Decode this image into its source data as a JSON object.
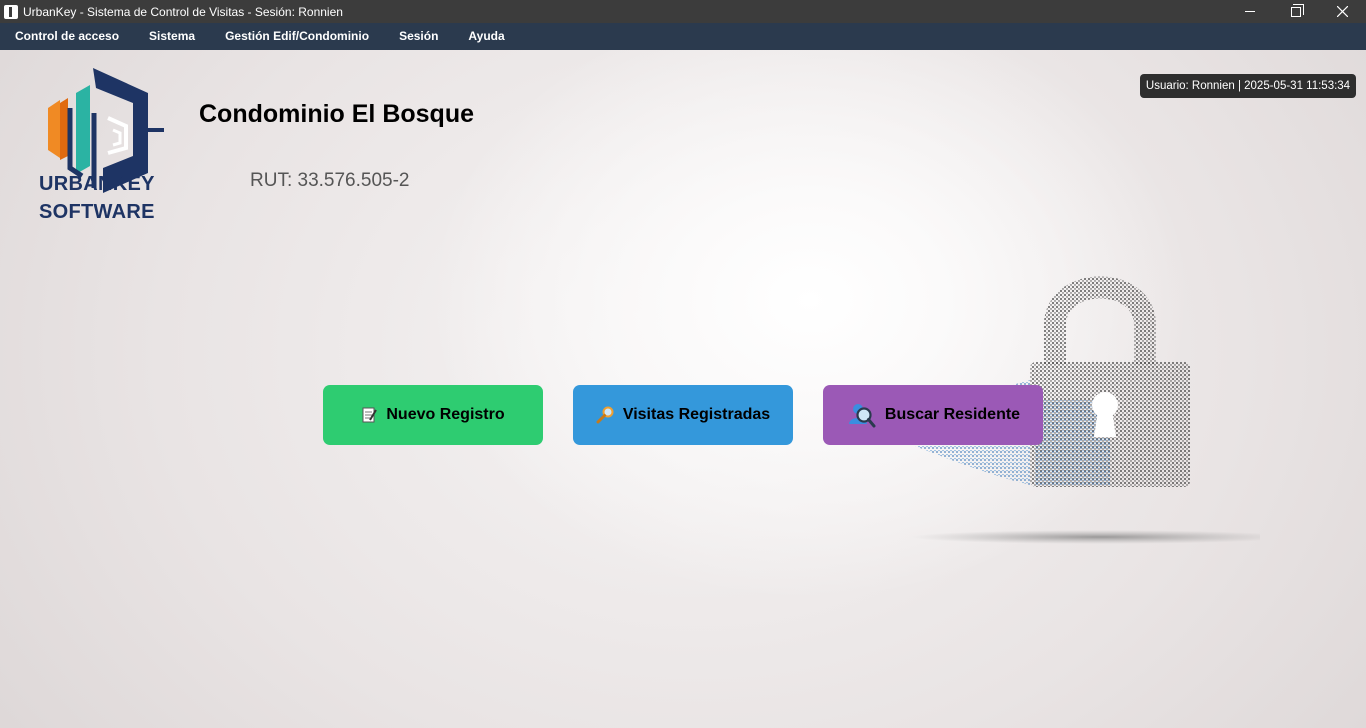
{
  "window": {
    "title": "UrbanKey - Sistema de Control de Visitas - Sesión: Ronnien",
    "controls": {
      "minimize": "minimize-icon",
      "restore": "restore-icon",
      "close": "close-icon"
    }
  },
  "menu": {
    "items": [
      {
        "label": "Control de acceso"
      },
      {
        "label": "Sistema"
      },
      {
        "label": "Gestión Edif/Condominio"
      },
      {
        "label": "Sesión"
      },
      {
        "label": "Ayuda"
      }
    ]
  },
  "logo": {
    "line1": "URBANKEY",
    "line2": "SOFTWARE"
  },
  "condominio": {
    "name": "Condominio El Bosque",
    "rut": "RUT: 33.576.505-2"
  },
  "user_badge": "Usuario: Ronnien | 2025-05-31 11:53:34",
  "actions": {
    "nuevo": {
      "label": "Nuevo Registro",
      "icon": "memo-icon",
      "color": "#2ecc71"
    },
    "visitas": {
      "label": "Visitas Registradas",
      "icon": "magnifier-icon",
      "color": "#3498db"
    },
    "buscar": {
      "label": "Buscar Residente",
      "icon": "search-user-icon",
      "color": "#9b59b6"
    }
  },
  "colors": {
    "titlebar": "#3c3c3c",
    "menubar": "#2b3a4e",
    "logo_navy": "#1e3464",
    "logo_orange": "#f08a24",
    "logo_teal": "#2bb3a3"
  }
}
